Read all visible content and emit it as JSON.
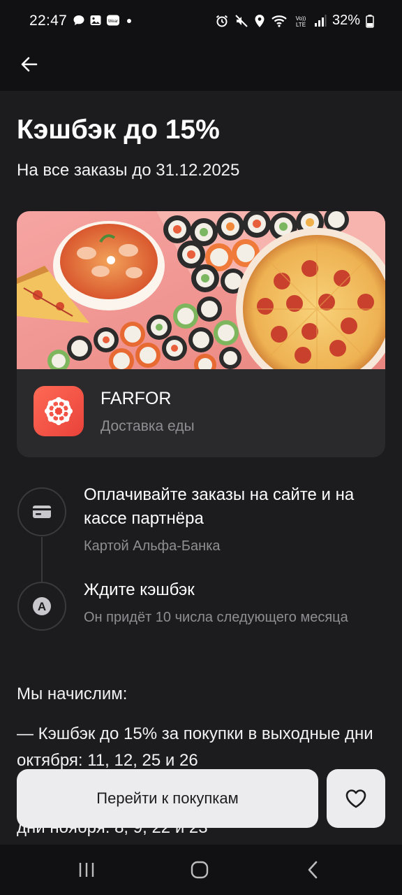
{
  "status_bar": {
    "time": "22:47",
    "battery": "32%",
    "left_icons": [
      "chat-bubble-icon",
      "gallery-icon",
      "wear-icon",
      "dot-icon"
    ],
    "right_icons": [
      "alarm-icon",
      "mute-icon",
      "location-icon",
      "wifi-icon",
      "volte-icon",
      "signal-icon",
      "battery-icon"
    ]
  },
  "header": {
    "back_icon": "arrow-left-icon"
  },
  "offer": {
    "title": "Кэшбэк до 15%",
    "subtitle": "На все заказы до 31.12.2025"
  },
  "partner": {
    "name": "FARFOR",
    "category": "Доставка еды",
    "logo_color": "#ef4a3b"
  },
  "steps": [
    {
      "title": "Оплачивайте заказы на сайте и на кассе партнёра",
      "description": "Картой Альфа-Банка",
      "icon": "card-icon"
    },
    {
      "title": "Ждите кэшбэк",
      "description": "Он придёт 10 числа следующего месяца",
      "icon": "alfa-a-icon"
    }
  ],
  "details": {
    "intro": "Мы начислим:",
    "items": [
      "— Кэшбэк до 15% за покупки в выходные дни октября: 11, 12, 25 и 26",
      "дни ноября: 8, 9, 22 и 23"
    ]
  },
  "actions": {
    "primary_label": "Перейти к покупкам",
    "favorite_icon": "heart-icon"
  },
  "nav": {
    "icons": [
      "recents-icon",
      "home-icon",
      "back-icon"
    ]
  },
  "colors": {
    "background": "#1c1c1e",
    "card": "#2a2a2d",
    "button": "#ececee",
    "muted_text": "#8e8e93"
  }
}
